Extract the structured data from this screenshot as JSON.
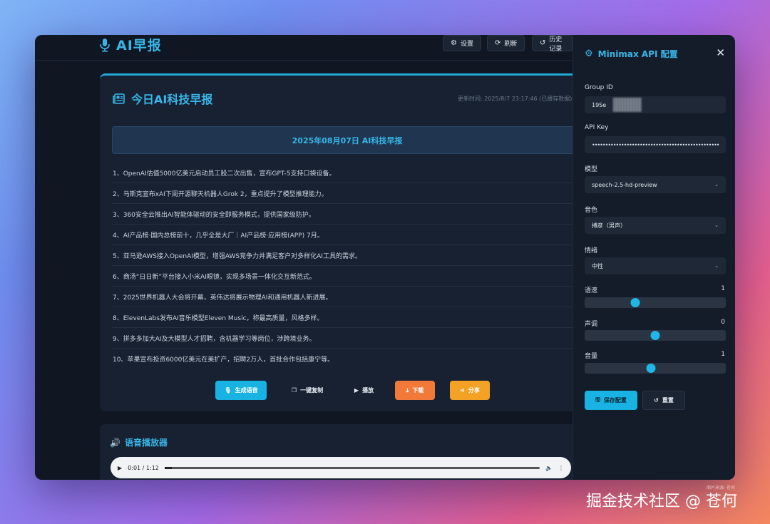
{
  "header": {
    "app_title": "AI早报",
    "buttons": [
      {
        "label": "设置",
        "icon": "gear-icon"
      },
      {
        "label": "刷新",
        "icon": "refresh-icon"
      },
      {
        "label": "历史记录",
        "icon": "history-icon"
      }
    ]
  },
  "report": {
    "title": "今日AI科技早报",
    "update_time": "更新时间: 2025/8/7 23:17:46 (已缓存数据)",
    "banner": "2025年08月07日 AI科技早报",
    "items": [
      "1、OpenAI估值5000亿美元启动员工股二次出售，宣布GPT-5支持口袋设备。",
      "2、马斯克宣布xAI下周开源聊天机器人Grok 2，重点提升了模型推理能力。",
      "3、360安全云推出AI智能体驱动的安全即服务模式，提供国家级防护。",
      "4、AI产品榜·国内总榜前十，几乎全是大厂｜AI产品榜·应用榜(APP) 7月。",
      "5、亚马逊AWS接入OpenAI模型，增强AWS竞争力并满足客户对多样化AI工具的需求。",
      "6、商汤“日日新”平台接入小米AI眼镜，实现多场景一体化交互新范式。",
      "7、2025世界机器人大会将开幕，英伟达将展示物理AI和通用机器人新进展。",
      "8、ElevenLabs发布AI音乐模型Eleven Music，称最高质量，风格多样。",
      "9、拼多多加大AI及大模型人才招聘，含机器学习等岗位，涉跨境业务。",
      "10、苹果宣布投资6000亿美元在美扩产，招聘2万人，首批合作包括康宁等。"
    ],
    "actions": {
      "generate": "生成语音",
      "copy": "一键复制",
      "play": "播放",
      "download": "下载",
      "share": "分享"
    }
  },
  "player": {
    "title": "语音播放器",
    "time": "0:01 / 1:12",
    "progress": 0.02
  },
  "config": {
    "title": "Minimax API 配置",
    "group_id_label": "Group ID",
    "group_id_value": "19Se",
    "api_key_label": "API Key",
    "api_key_value": "••••••••••••••••••••••••••••••••••••••••••••••••••••••••••••",
    "model_label": "模型",
    "model_value": "speech-2.5-hd-preview",
    "voice_label": "音色",
    "voice_value": "搏彦（男声）",
    "emotion_label": "情绪",
    "emotion_value": "中性",
    "speed_label": "语速",
    "speed_value": "1",
    "speed_fraction": 0.36,
    "pitch_label": "声调",
    "pitch_value": "0",
    "pitch_fraction": 0.5,
    "volume_label": "音量",
    "volume_value": "1",
    "volume_fraction": 0.47,
    "save_label": "保存配置",
    "reset_label": "重置"
  },
  "watermark": {
    "small": "图片来源: 苍何",
    "main": "掘金技术社区 @ 苍何"
  },
  "colors": {
    "accent": "#38b6e8",
    "primary_button": "#19b3e3",
    "download": "#f17a3a",
    "share": "#f3a226"
  }
}
